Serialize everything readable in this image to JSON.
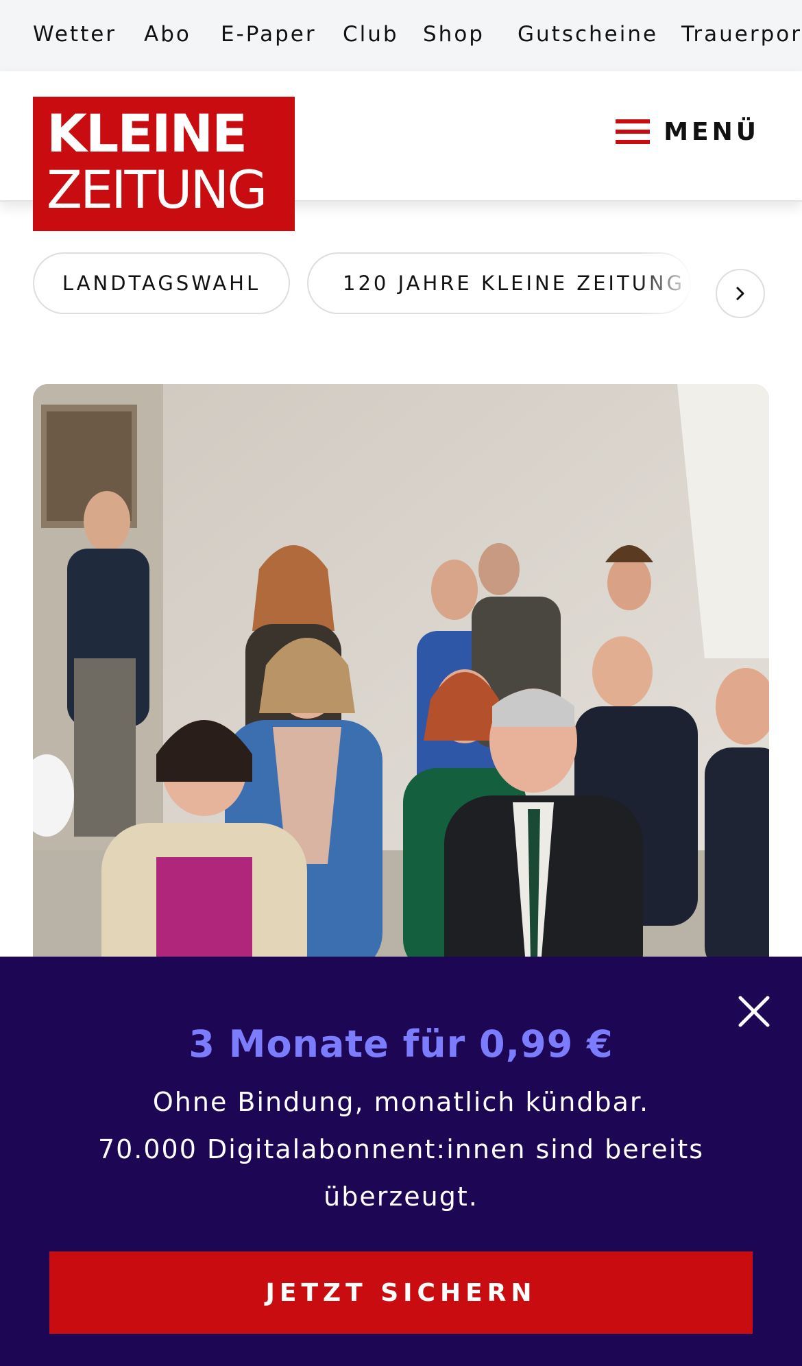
{
  "topnav": {
    "items": [
      {
        "label": "Wetter"
      },
      {
        "label": "Abo"
      },
      {
        "label": "E-Paper"
      },
      {
        "label": "Club"
      },
      {
        "label": "Shop"
      },
      {
        "label": "Gutscheine"
      },
      {
        "label": "Trauerportal"
      }
    ]
  },
  "header": {
    "logo_line1": "KLEINE",
    "logo_line2": "ZEITUNG",
    "menu_label": "MENÜ"
  },
  "topics": {
    "chips": [
      {
        "label": "LANDTAGSWAHL"
      },
      {
        "label": "120 JAHRE KLEINE ZEITUNG"
      }
    ],
    "next_icon": "chevron-right-icon"
  },
  "promo": {
    "headline": "3 Monate für 0,99 €",
    "line1": "Ohne Bindung, monatlich kündbar.",
    "line2": "70.000 Digitalabonnent:innen sind bereits überzeugt.",
    "cta_label": "JETZT SICHERN",
    "close_icon": "close-icon"
  },
  "colors": {
    "brand_red": "#c90c0f",
    "promo_bg": "#1d0653",
    "promo_accent": "#7c7cff"
  }
}
